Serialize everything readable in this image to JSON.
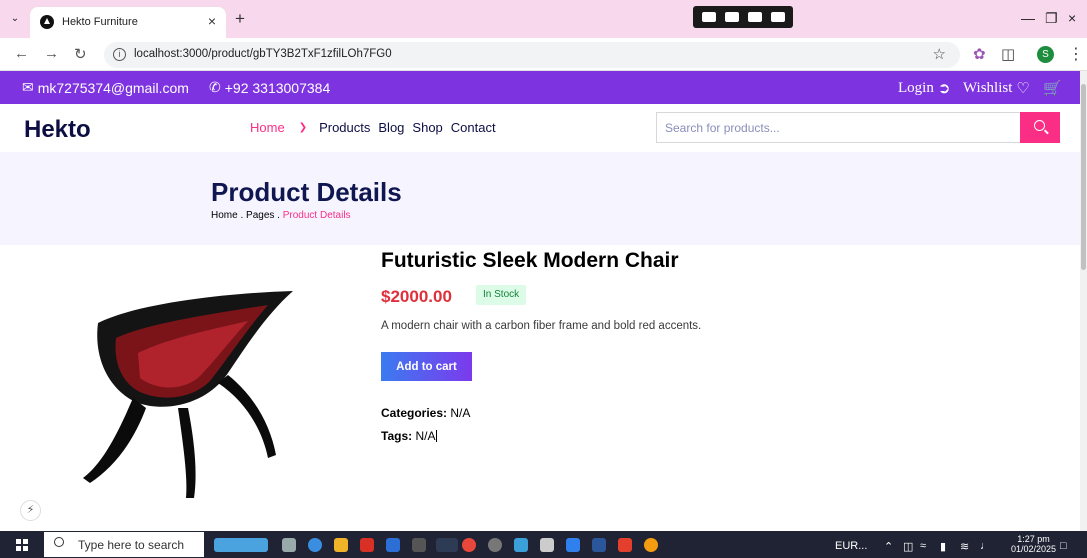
{
  "browser": {
    "tab_title": "Hekto Furniture",
    "url": "localhost:3000/product/gbTY3B2TxF1zfilLOh7FG0",
    "profile_initial": "S"
  },
  "topbar": {
    "email": "mk7275374@gmail.com",
    "phone": "+92 3313007384",
    "login": "Login",
    "wishlist": "Wishlist"
  },
  "header": {
    "logo": "Hekto",
    "nav": [
      "Home",
      "Products",
      "Blog",
      "Shop",
      "Contact"
    ],
    "search_placeholder": "Search for products..."
  },
  "banner": {
    "title": "Product Details",
    "breadcrumb_home": "Home",
    "breadcrumb_pages": "Pages",
    "breadcrumb_current": "Product Details"
  },
  "product": {
    "name": "Futuristic Sleek Modern Chair",
    "price": "$2000.00",
    "stock": "In Stock",
    "description": "A modern chair with a carbon fiber frame and bold red accents.",
    "add_to_cart": "Add to cart",
    "categories_label": "Categories:",
    "categories_value": "N/A",
    "tags_label": "Tags:",
    "tags_value": "N/A"
  },
  "taskbar": {
    "search": "Type here to search",
    "tray_app": "EUR...",
    "time": "1:27 pm",
    "date": "01/02/2025"
  },
  "colors": {
    "topbar": "#7e33e0",
    "accent": "#fb2e86",
    "navy": "#101750",
    "price": "#e0303b"
  }
}
